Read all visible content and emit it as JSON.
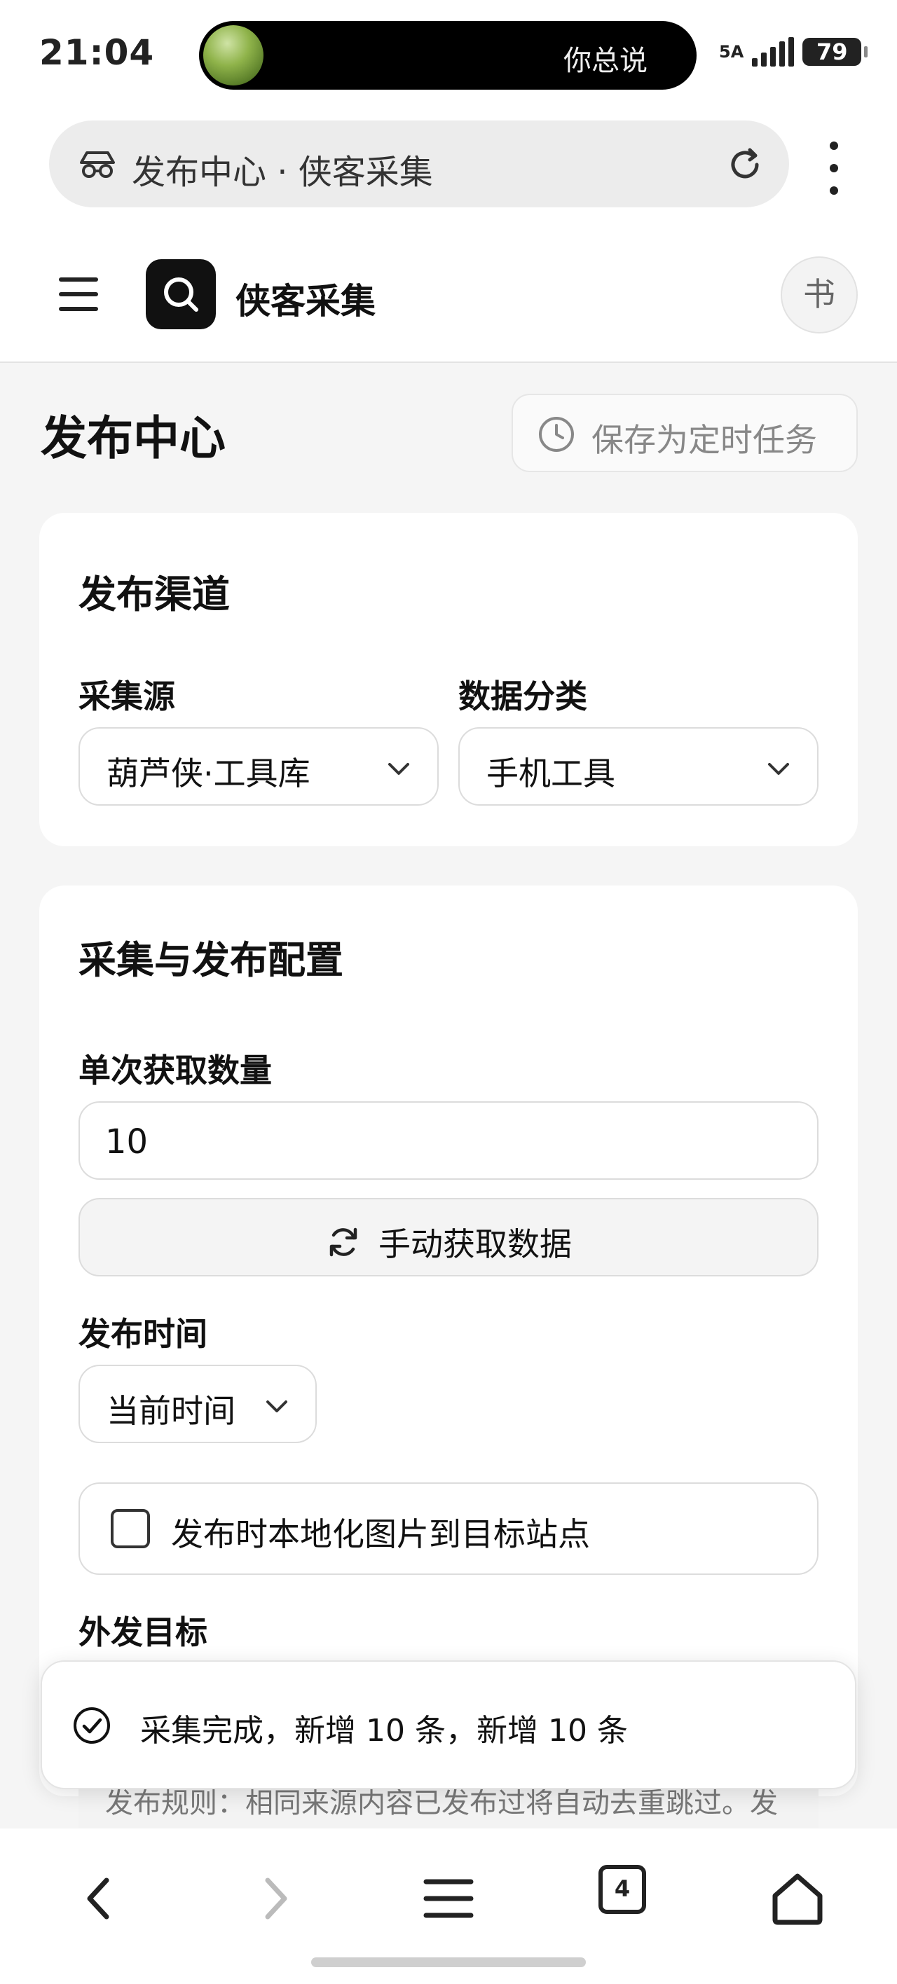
{
  "status_bar": {
    "time": "21:04",
    "island_text": "你总说",
    "network": "5A",
    "battery": "79"
  },
  "browser": {
    "tab_title": "发布中心 · 侠客采集",
    "tab_count": "4"
  },
  "app_header": {
    "brand": "侠客采集",
    "avatar_char": "书"
  },
  "page": {
    "title": "发布中心",
    "schedule_button": "保存为定时任务"
  },
  "publish_channel": {
    "title": "发布渠道",
    "source_label": "采集源",
    "source_value": "葫芦侠·工具库",
    "category_label": "数据分类",
    "category_value": "手机工具"
  },
  "config": {
    "title": "采集与发布配置",
    "count_label": "单次获取数量",
    "count_value": "10",
    "fetch_button": "手动获取数据",
    "time_label": "发布时间",
    "time_value": "当前时间",
    "localize_checkbox": "发布时本地化图片到目标站点",
    "localize_checked": false,
    "target_label": "外发目标",
    "rules_text": "发布规则：相同来源内容已发布过将自动去重跳过。发布中心只使用已添加并启用的渠道。"
  },
  "toast": {
    "message": "采集完成，新增 10 条，新增 10 条"
  },
  "icons": {
    "url_icon": "incognito-glasses-icon",
    "reload": "reload-icon",
    "menu": "kebab-menu-icon",
    "hamburger": "hamburger-icon",
    "logo": "search-icon",
    "clock": "clock-icon",
    "chevron": "chevron-down-icon",
    "refresh": "refresh-icon",
    "check": "check-circle-icon",
    "back": "back-arrow-icon",
    "forward": "forward-arrow-icon",
    "menu_lines": "menu-lines-icon",
    "tabs": "tabs-icon",
    "home": "home-icon"
  }
}
